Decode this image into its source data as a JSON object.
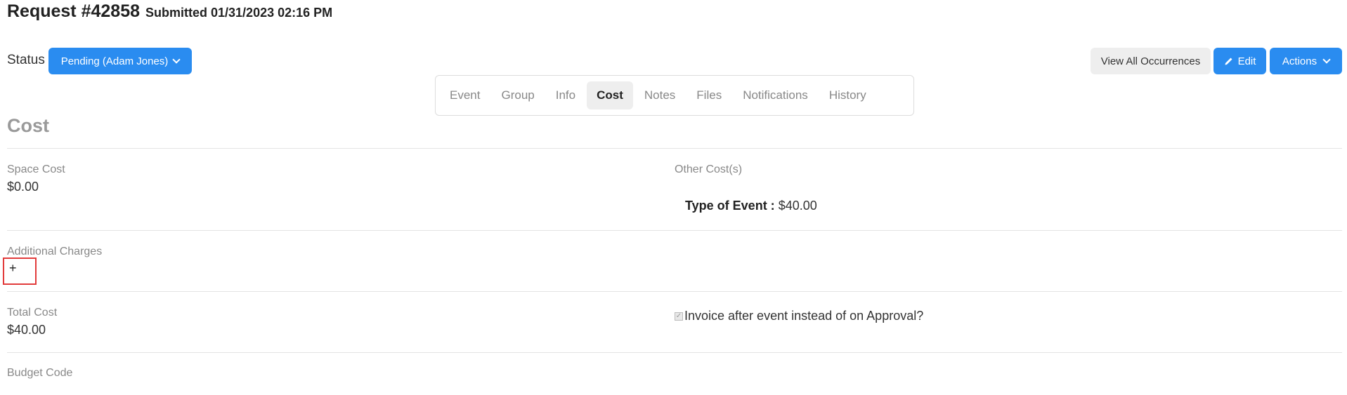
{
  "header": {
    "title": "Request #42858",
    "submitted": "Submitted 01/31/2023 02:16 PM"
  },
  "status": {
    "label": "Status",
    "value": "Pending (Adam Jones)"
  },
  "toolbar": {
    "view_all_label": "View All Occurrences",
    "edit_label": "Edit",
    "actions_label": "Actions"
  },
  "tabs": [
    {
      "label": "Event"
    },
    {
      "label": "Group"
    },
    {
      "label": "Info"
    },
    {
      "label": "Cost",
      "active": true
    },
    {
      "label": "Notes"
    },
    {
      "label": "Files"
    },
    {
      "label": "Notifications"
    },
    {
      "label": "History"
    }
  ],
  "section": {
    "title": "Cost"
  },
  "cost": {
    "space_cost_label": "Space Cost",
    "space_cost_value": "$0.00",
    "other_costs_label": "Other Cost(s)",
    "type_of_event_label": "Type of Event :",
    "type_of_event_value": "$40.00",
    "additional_charges_label": "Additional Charges",
    "add_symbol": "+",
    "total_cost_label": "Total Cost",
    "total_cost_value": "$40.00",
    "invoice_label": "Invoice after event instead of on Approval?",
    "invoice_checked": true,
    "budget_code_label": "Budget Code"
  },
  "colors": {
    "primary": "#2a8cf0",
    "highlight": "#e23b3b"
  }
}
